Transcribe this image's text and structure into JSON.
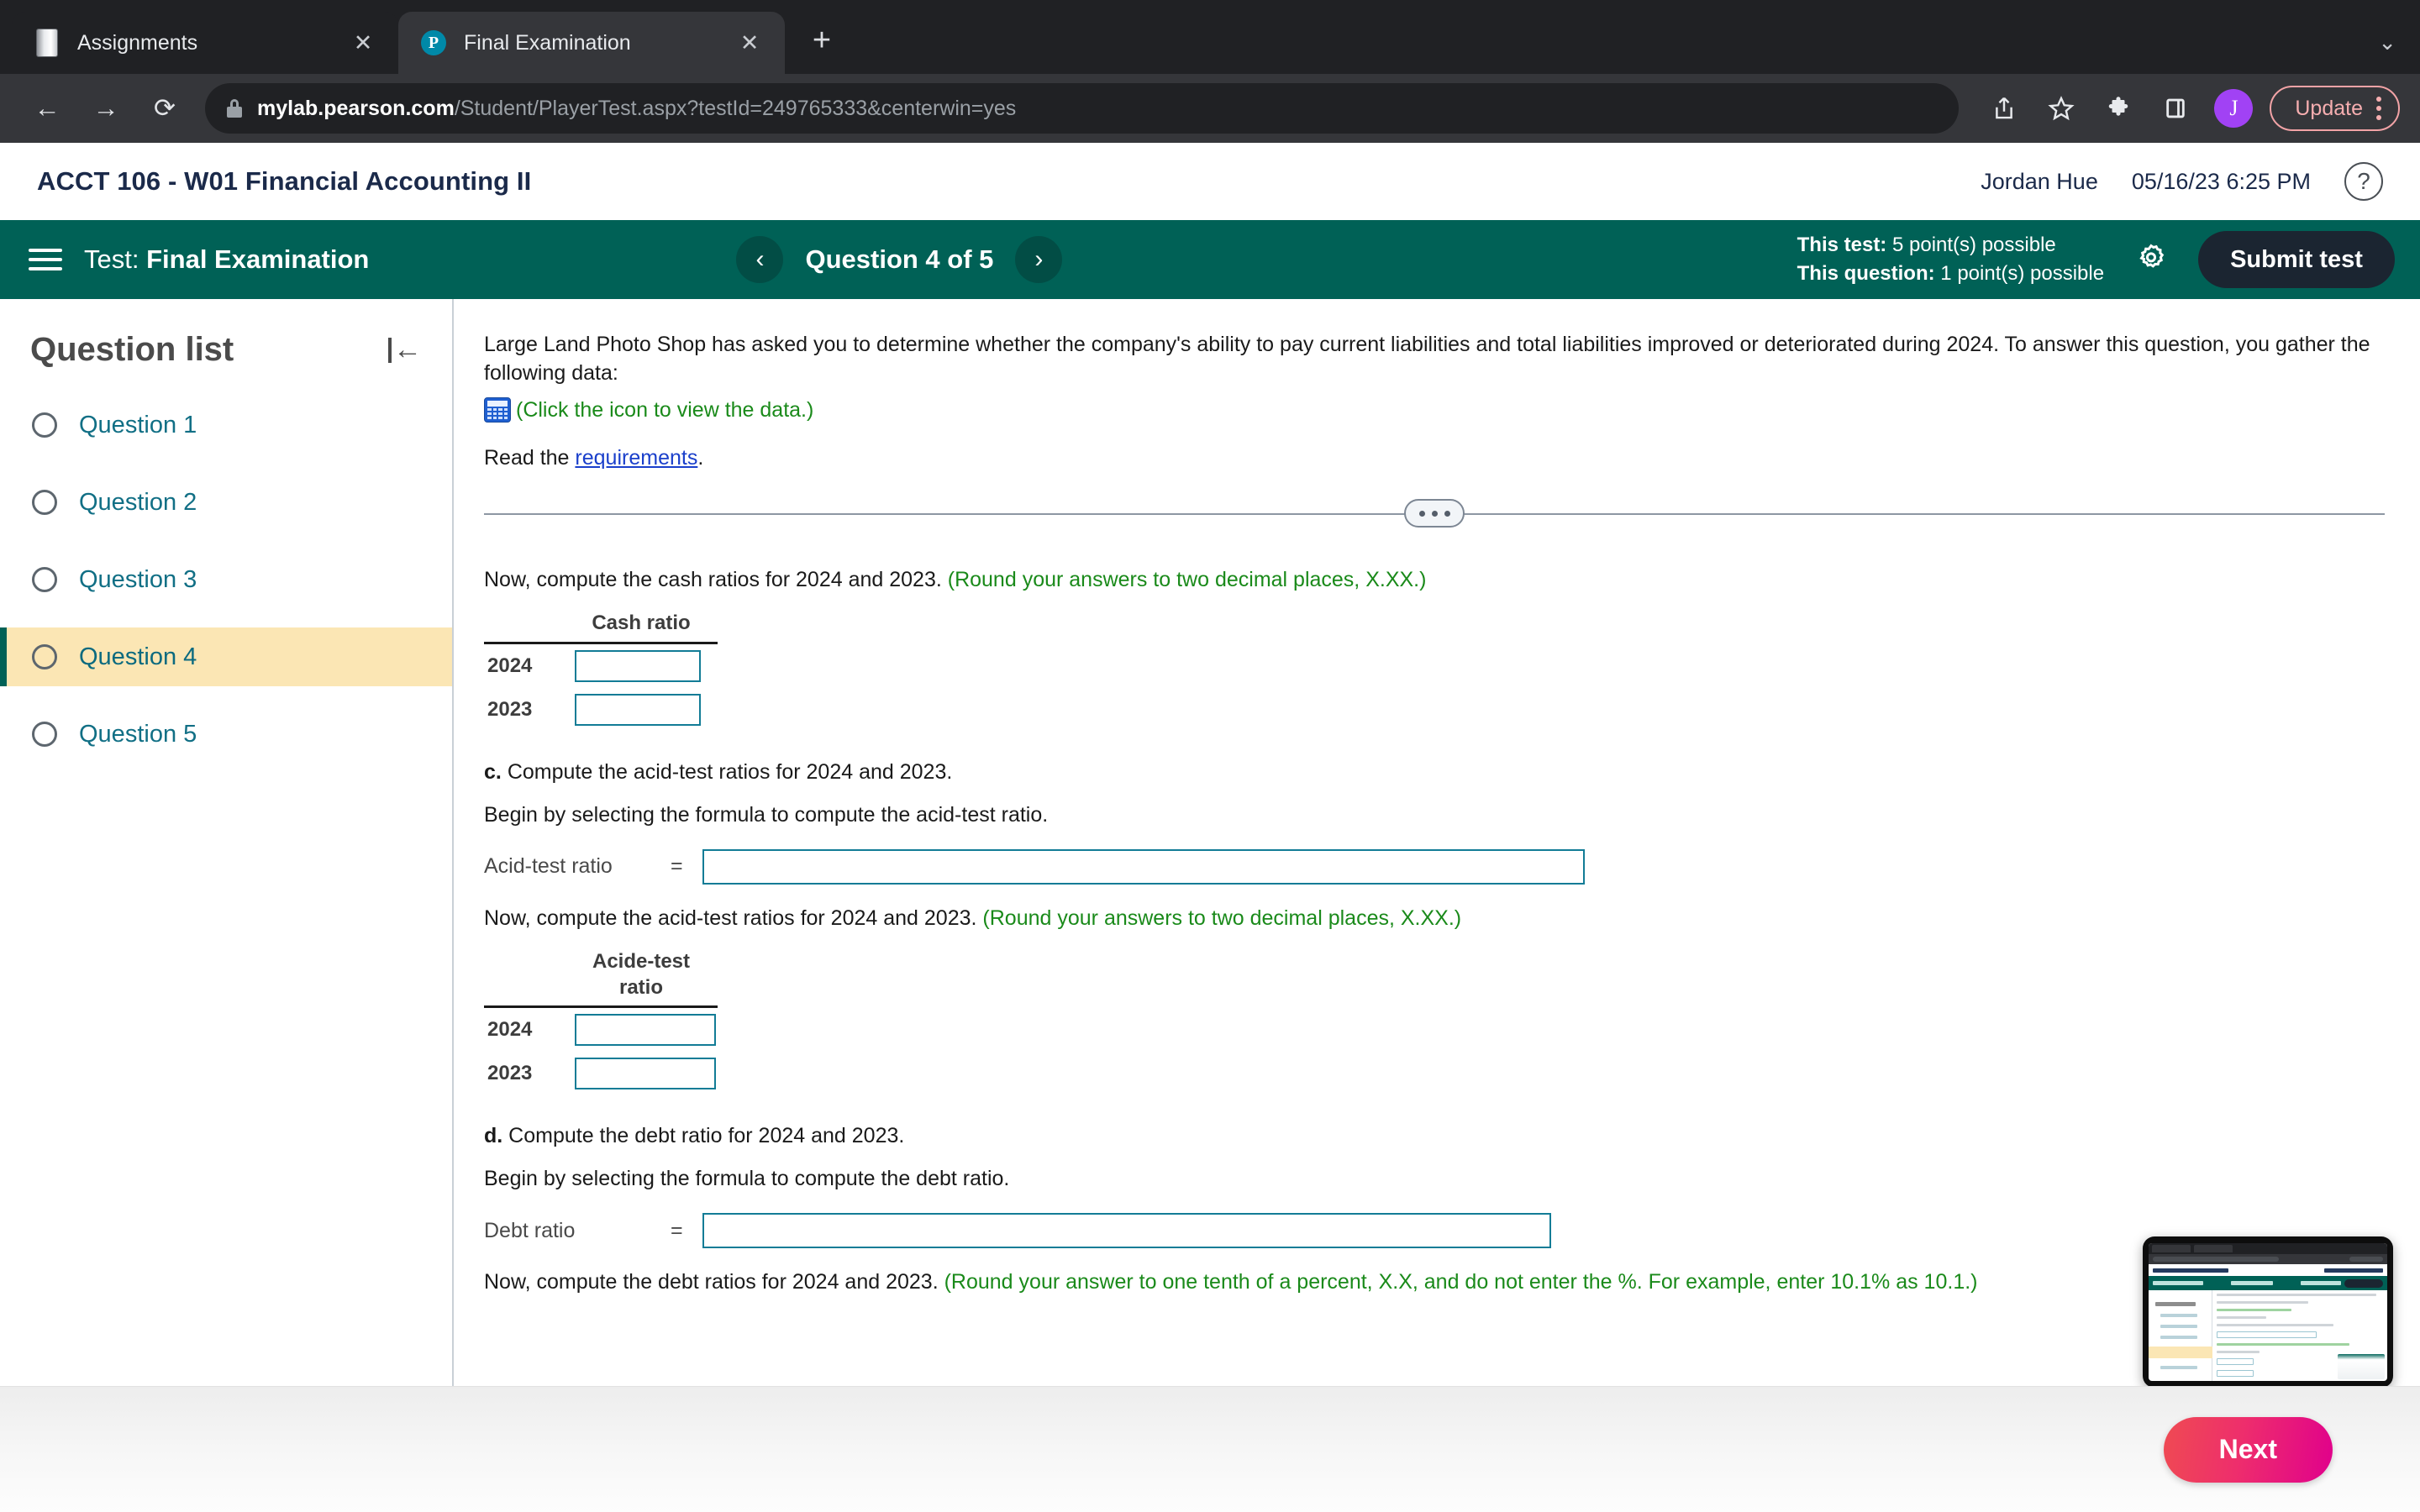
{
  "browser": {
    "tabs": [
      {
        "title": "Assignments",
        "favicon": "book-icon",
        "active": false,
        "close_label": "✕"
      },
      {
        "title": "Final Examination",
        "favicon": "pearson-p-icon",
        "active": true,
        "close_label": "✕"
      }
    ],
    "new_tab_label": "+",
    "tabstrip_chevron": "⌄",
    "nav": {
      "back": "←",
      "forward": "→",
      "reload": "⟳"
    },
    "url": {
      "host": "mylab.pearson.com",
      "path": "/Student/PlayerTest.aspx?testId=249765333&centerwin=yes",
      "lock_icon": "lock-icon"
    },
    "toolbar_icons": [
      "share-icon",
      "bookmark-star-icon",
      "extensions-puzzle-icon",
      "sidebar-panel-icon"
    ],
    "profile_initial": "J",
    "update_label": "Update",
    "menu_icon": "kebab-menu-icon"
  },
  "app_header": {
    "course_title": "ACCT 106 - W01 Financial Accounting II",
    "user_name": "Jordan Hue",
    "datetime": "05/16/23 6:25 PM",
    "help_icon": "?"
  },
  "test_bar": {
    "menu_icon": "hamburger-icon",
    "test_prefix": "Test:",
    "test_name": "Final Examination",
    "prev_icon": "‹",
    "next_icon": "›",
    "question_counter": "Question 4 of 5",
    "points_test_label": "This test:",
    "points_test_value": "5 point(s) possible",
    "points_question_label": "This question:",
    "points_question_value": "1 point(s) possible",
    "settings_icon": "gear-icon",
    "submit_label": "Submit test",
    "bar_color": "#006156",
    "submit_color": "#1b2531"
  },
  "sidebar": {
    "title": "Question list",
    "collapse_icon": "collapse-left-icon",
    "items": [
      {
        "label": "Question 1",
        "active": false
      },
      {
        "label": "Question 2",
        "active": false
      },
      {
        "label": "Question 3",
        "active": false
      },
      {
        "label": "Question 4",
        "active": true
      },
      {
        "label": "Question 5",
        "active": false
      }
    ],
    "active_bg": "#fbe6b4",
    "link_color": "#116f85"
  },
  "question": {
    "intro": "Large Land Photo Shop has asked you to determine whether the company's ability to pay current liabilities and total liabilities improved or deteriorated during 2024. To answer this question, you gather the following data:",
    "data_icon": "spreadsheet-data-icon",
    "data_hint": "(Click the icon to view the data.)",
    "read_prefix": "Read the ",
    "read_link": "requirements",
    "read_suffix": ".",
    "divider_icon": "expand-dots-icon",
    "cash": {
      "prompt": "Now, compute the cash ratios for 2024 and 2023.",
      "rounding_note": "(Round your answers to two decimal places, X.XX.)",
      "column_header": "Cash ratio",
      "rows": [
        {
          "year": "2024",
          "value": ""
        },
        {
          "year": "2023",
          "value": ""
        }
      ]
    },
    "part_c": {
      "letter": "c.",
      "prompt": "Compute the acid-test ratios for 2024 and 2023.",
      "formula_instruction": "Begin by selecting the formula to compute the acid-test ratio.",
      "formula_label": "Acid-test ratio",
      "equals": "=",
      "formula_value": "",
      "table_prompt": "Now, compute the acid-test ratios for 2024 and 2023.",
      "rounding_note": "(Round your answers to two decimal places, X.XX.)",
      "column_header_line1": "Acide-test",
      "column_header_line2": "ratio",
      "rows": [
        {
          "year": "2024",
          "value": ""
        },
        {
          "year": "2023",
          "value": ""
        }
      ]
    },
    "part_d": {
      "letter": "d.",
      "prompt": "Compute the debt ratio for 2024 and 2023.",
      "formula_instruction": "Begin by selecting the formula to compute the debt ratio.",
      "formula_label": "Debt ratio",
      "equals": "=",
      "formula_value": "",
      "table_prompt": "Now, compute the debt ratios for 2024 and 2023.",
      "rounding_note": "(Round your answer to one tenth of a percent, X.X, and do not enter the %. For example, enter 10.1% as 10.1.)"
    },
    "input_border_color": "#127c96",
    "note_color": "#1a8a1a"
  },
  "footer": {
    "next_label": "Next",
    "next_gradient_from": "#ef4b52",
    "next_gradient_to": "#e0008c"
  },
  "pip": {
    "name": "screen-share-preview"
  }
}
